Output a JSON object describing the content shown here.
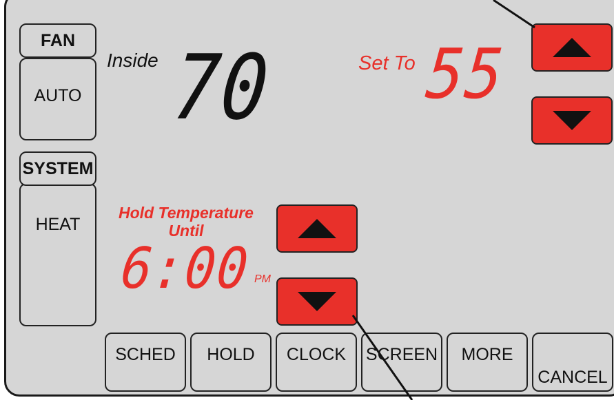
{
  "left_panel": {
    "fan_label": "FAN",
    "fan_value": "AUTO",
    "system_label": "SYSTEM",
    "system_value": "HEAT"
  },
  "inside": {
    "label": "Inside",
    "temperature": "70"
  },
  "setpoint": {
    "label": "Set To",
    "temperature": "55"
  },
  "hold": {
    "title_line1": "Hold Temperature",
    "title_line2": "Until",
    "time": "6:00",
    "ampm": "PM"
  },
  "icons": {
    "up": "triangle-up-icon",
    "down": "triangle-down-icon"
  },
  "colors": {
    "accent_red": "#e8302a",
    "screen_bg": "#d6d6d6",
    "outline": "#222222"
  },
  "soft_buttons": {
    "sched": "SCHED",
    "hold": "HOLD",
    "clock": "CLOCK",
    "screen": "SCREEN",
    "more": "MORE",
    "cancel": "CANCEL"
  }
}
